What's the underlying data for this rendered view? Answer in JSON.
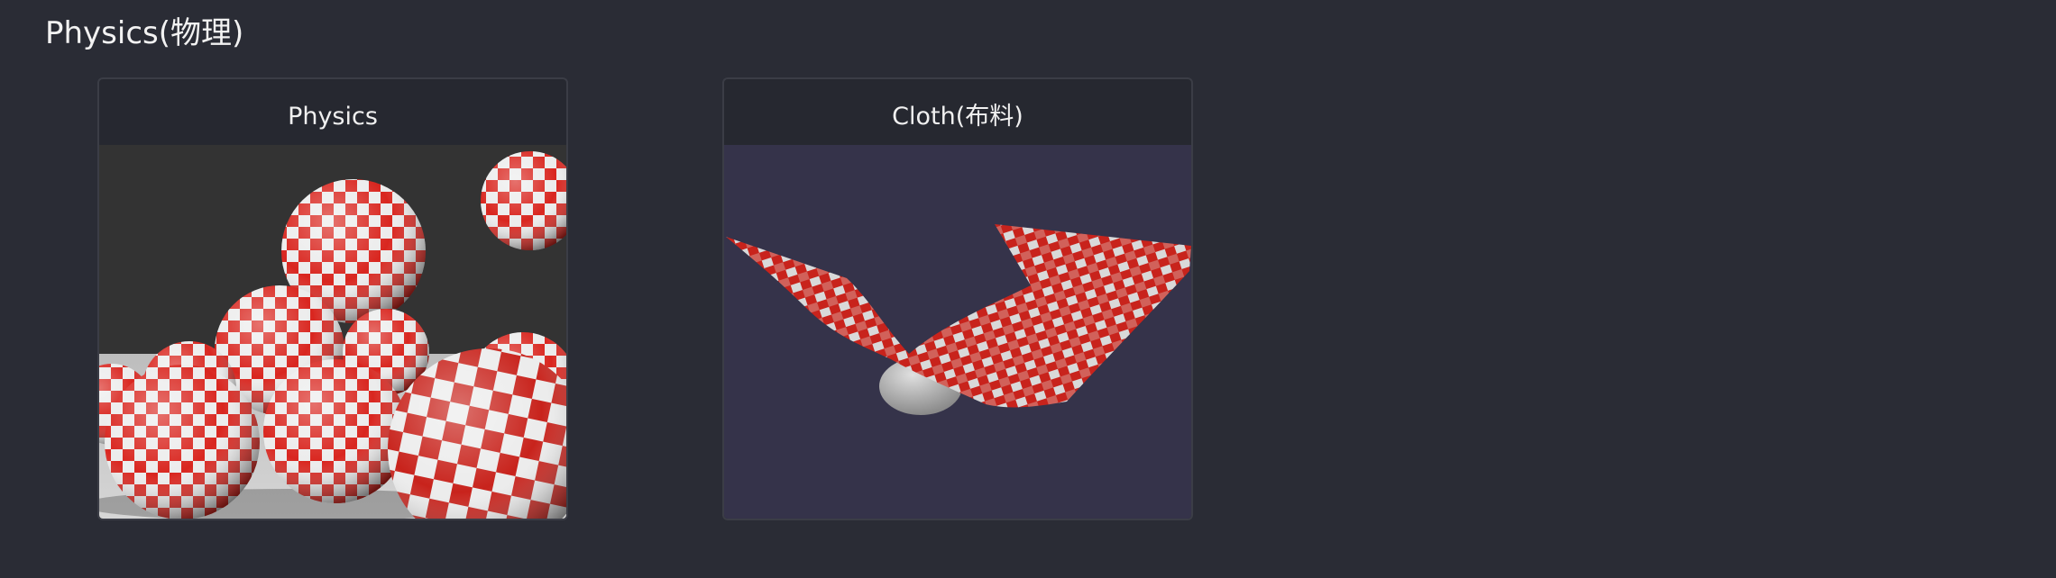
{
  "section": {
    "title": "Physics(物理)"
  },
  "cards": [
    {
      "label": "Physics",
      "image": "checkered-balls-physics-scene"
    },
    {
      "label": "Cloth(布料)",
      "image": "checkered-cloth-over-sphere-scene"
    }
  ],
  "colors": {
    "background": "#2a2c35",
    "card_background": "#262830",
    "card_border": "#3b3d46",
    "checker_red": "#d9261f",
    "checker_white": "#ececec"
  }
}
